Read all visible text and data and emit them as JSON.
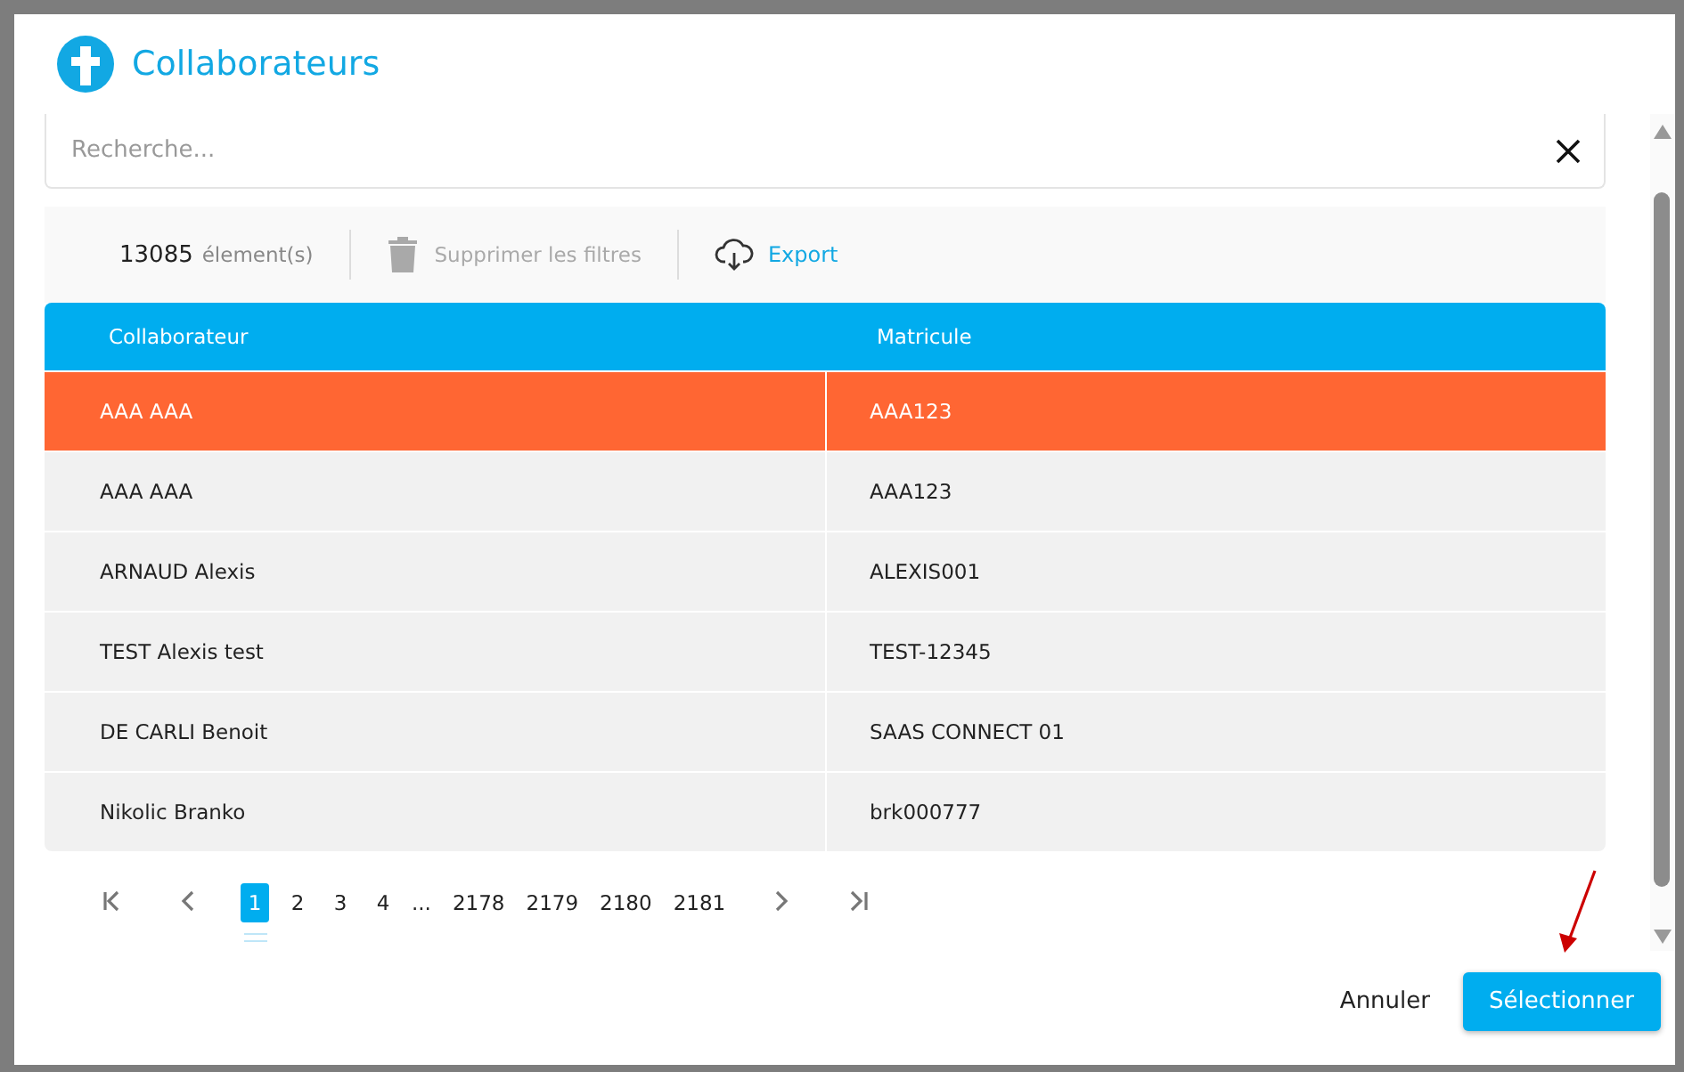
{
  "dialog": {
    "title": "Collaborateurs"
  },
  "search": {
    "placeholder": "Recherche..."
  },
  "toolbar": {
    "count": "13085",
    "count_label": "élement(s)",
    "clear_filters": {
      "label": "Supprimer les filtres",
      "disabled": true
    },
    "export": "Export"
  },
  "table": {
    "columns": [
      "Collaborateur",
      "Matricule"
    ],
    "rows": [
      {
        "cells": [
          "AAA AAA",
          "AAA123"
        ],
        "selected": true
      },
      {
        "cells": [
          "AAA AAA",
          "AAA123"
        ],
        "selected": false
      },
      {
        "cells": [
          "ARNAUD Alexis",
          "ALEXIS001"
        ],
        "selected": false
      },
      {
        "cells": [
          "TEST Alexis test",
          "TEST-12345"
        ],
        "selected": false
      },
      {
        "cells": [
          "DE CARLI Benoit",
          "SAAS CONNECT 01"
        ],
        "selected": false
      },
      {
        "cells": [
          "Nikolic Branko",
          "brk000777"
        ],
        "selected": false
      }
    ]
  },
  "pagination": {
    "pages": [
      {
        "kind": "page",
        "label": "1",
        "selected": true
      },
      {
        "kind": "page",
        "label": "2",
        "selected": false
      },
      {
        "kind": "page",
        "label": "3",
        "selected": false
      },
      {
        "kind": "page",
        "label": "4",
        "selected": false
      },
      {
        "kind": "ellipsis",
        "label": "..."
      },
      {
        "kind": "page",
        "label": "2178",
        "selected": false
      },
      {
        "kind": "page",
        "label": "2179",
        "selected": false
      },
      {
        "kind": "page",
        "label": "2180",
        "selected": false
      },
      {
        "kind": "page",
        "label": "2181",
        "selected": false
      }
    ]
  },
  "buttons": {
    "cancel": "Annuler",
    "select": "Sélectionner"
  }
}
